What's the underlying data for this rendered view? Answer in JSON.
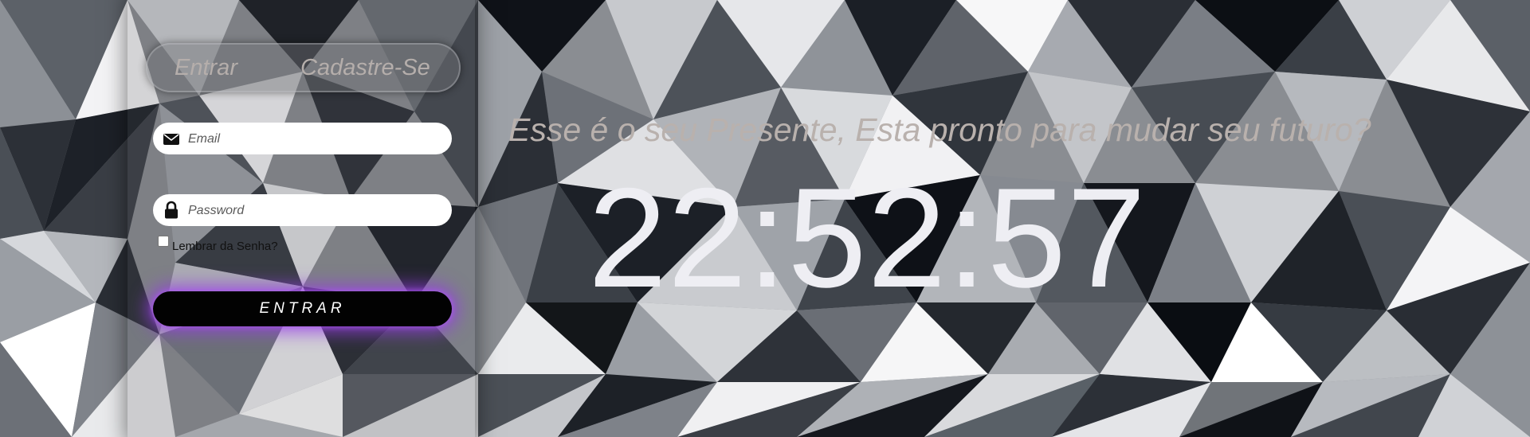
{
  "login_panel": {
    "tabs": {
      "login": "Entrar",
      "register": "Cadastre-Se"
    },
    "email": {
      "icon": "envelope-icon",
      "placeholder": "Email",
      "value": ""
    },
    "password": {
      "icon": "lock-icon",
      "placeholder": "Password",
      "value": ""
    },
    "remember_label": "Lembrar da Senha?",
    "remember_checked": false,
    "submit_label": "ENTRAR"
  },
  "headline": "Esse é o seu Presente, Esta pronto para mudar seu futuro?",
  "clock": "22:52:57",
  "colors": {
    "submit_glow": "#9b3cf0",
    "headline": "#b9b1ad",
    "clock": "#eeeef3",
    "toggle_text": "#b5aeab"
  }
}
